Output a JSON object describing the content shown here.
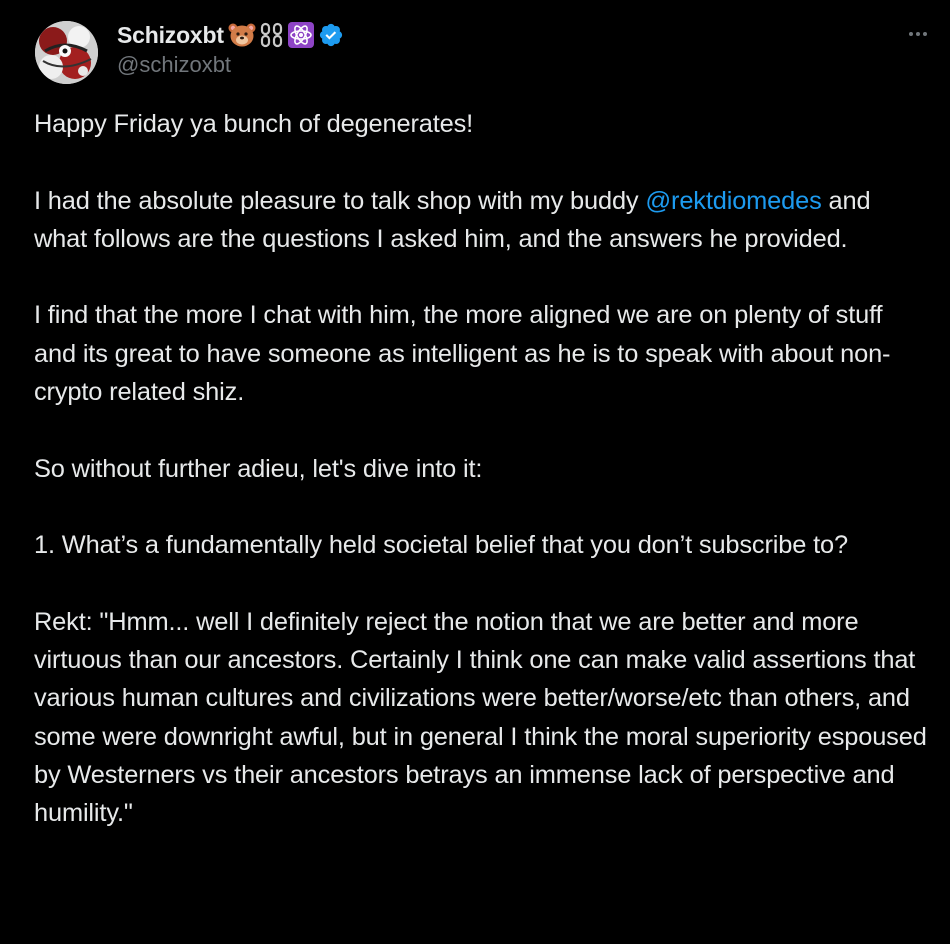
{
  "author": {
    "display_name": "Schizoxbt",
    "handle": "@schizoxbt",
    "name_emojis": [
      "bear-face-emoji",
      "chain-emoji",
      "atom-emoji"
    ],
    "verified": true,
    "verified_color": "#1d9bf0"
  },
  "menu": {
    "icon": "more-dots-icon"
  },
  "post": {
    "greeting": "Happy Friday ya bunch of degenerates!",
    "intro_before": "I had the absolute pleasure to talk shop with my buddy ",
    "intro_mention": "@rektdiomedes",
    "intro_after": " and what follows are the questions I asked him, and the answers he provided.",
    "para2": "I find that the more I chat with him, the more aligned we are on plenty of stuff and its great to have someone as intelligent as he is to speak with about non-crypto related shiz.",
    "para3": "So without further adieu, let's dive into it:",
    "question1": "1. What’s a fundamentally held societal belief that you don’t subscribe to?",
    "answer1": "Rekt: \"Hmm... well I definitely reject the notion that we are better and more virtuous than our ancestors. Certainly I think one can make valid assertions that various human cultures and civilizations were better/worse/etc than others, and some were downright awful, but in general I think the moral superiority espoused by Westerners vs their ancestors betrays an immense lack of perspective and humility.\""
  },
  "colors": {
    "background": "#000000",
    "text": "#e7e9ea",
    "muted": "#71767b",
    "link": "#1d9bf0"
  }
}
